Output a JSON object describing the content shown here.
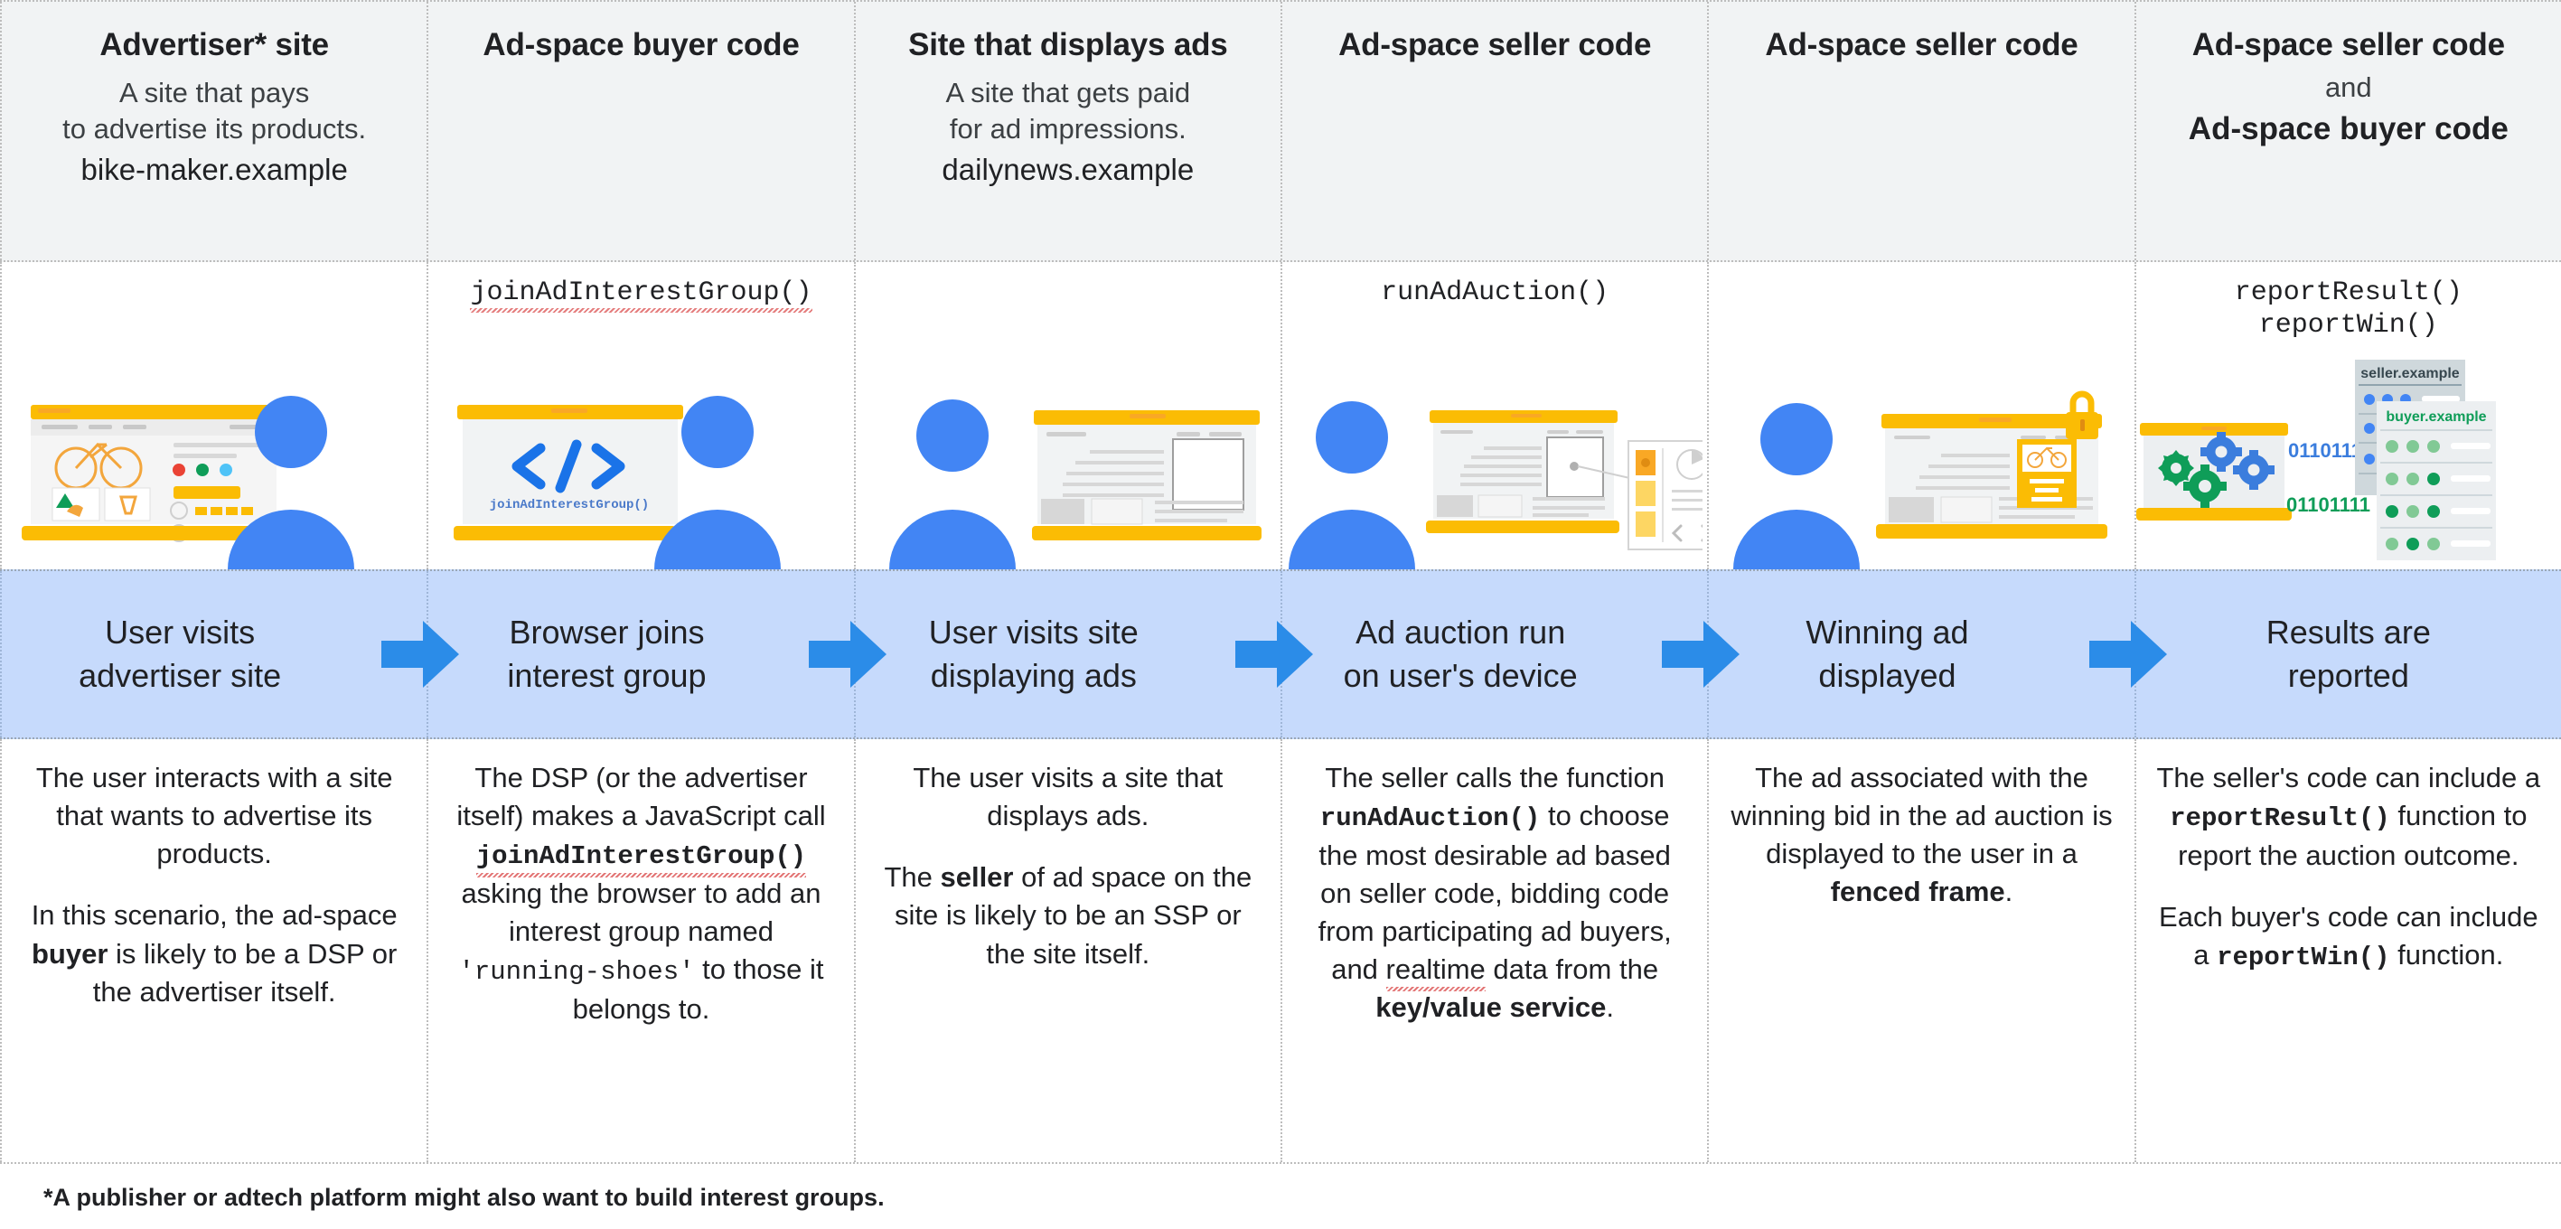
{
  "columns": [
    {
      "header": {
        "title": "Advertiser* site",
        "desc_lines": [
          "A site that pays",
          "to advertise its products."
        ],
        "domain": "bike-maker.example"
      },
      "api": "",
      "illustration": "user-at-advertiser-site-illustration",
      "flow": {
        "label_lines": [
          "User visits",
          "advertiser site"
        ],
        "arrow": true
      },
      "body": [
        {
          "parts": [
            {
              "t": "The user interacts with a site that wants to advertise its products.",
              "s": "plain"
            }
          ]
        },
        {
          "parts": [
            {
              "t": "In this scenario, the ad-space ",
              "s": "plain"
            },
            {
              "t": "buyer",
              "s": "bold"
            },
            {
              "t": " is likely to be a DSP or the advertiser itself.",
              "s": "plain"
            }
          ]
        }
      ]
    },
    {
      "header": {
        "title": "Ad-space buyer code",
        "desc_lines": [],
        "domain": ""
      },
      "api": "joinAdInterestGroup()",
      "api_squiggle": true,
      "illustration": "buyer-code-screen-illustration",
      "illustration_caption": "joinAdInterestGroup()",
      "flow": {
        "label_lines": [
          "Browser joins",
          "interest group"
        ],
        "arrow": true
      },
      "body": [
        {
          "parts": [
            {
              "t": "The DSP (or the advertiser itself) makes a JavaScript call ",
              "s": "plain"
            },
            {
              "t": "joinAdInterestGroup()",
              "s": "code-squiggle"
            },
            {
              "t": " asking the browser to add an interest group named ",
              "s": "plain"
            },
            {
              "t": "'running-shoes'",
              "s": "code-plain"
            },
            {
              "t": " to those it belongs to.",
              "s": "plain"
            }
          ]
        }
      ]
    },
    {
      "header": {
        "title": "Site that displays ads",
        "desc_lines": [
          "A site that gets paid",
          "for ad impressions."
        ],
        "domain": "dailynews.example"
      },
      "api": "",
      "illustration": "user-viewing-news-site-illustration",
      "flow": {
        "label_lines": [
          "User visits site",
          "displaying ads"
        ],
        "arrow": true
      },
      "body": [
        {
          "parts": [
            {
              "t": "The user visits a site that displays ads.",
              "s": "plain"
            }
          ]
        },
        {
          "parts": [
            {
              "t": "The ",
              "s": "plain"
            },
            {
              "t": "seller",
              "s": "bold"
            },
            {
              "t": " of ad space on the site is likely to be an SSP or the site itself.",
              "s": "plain"
            }
          ]
        }
      ]
    },
    {
      "header": {
        "title": "Ad-space seller code",
        "desc_lines": [],
        "domain": ""
      },
      "api": "runAdAuction()",
      "api_squiggle": false,
      "illustration": "ad-auction-on-device-illustration",
      "flow": {
        "label_lines": [
          "Ad auction run",
          "on user's device"
        ],
        "arrow": true
      },
      "body": [
        {
          "parts": [
            {
              "t": "The seller calls the function ",
              "s": "plain"
            },
            {
              "t": "runAdAuction()",
              "s": "code"
            },
            {
              "t": " to choose the most desirable ad based on seller code, bidding code from participating ad buyers, and ",
              "s": "plain"
            },
            {
              "t": "realtime",
              "s": "squiggle-plain"
            },
            {
              "t": " data from the ",
              "s": "plain"
            },
            {
              "t": "key/value service",
              "s": "bold"
            },
            {
              "t": ".",
              "s": "plain"
            }
          ]
        }
      ]
    },
    {
      "header": {
        "title": "Ad-space seller code",
        "desc_lines": [],
        "domain": ""
      },
      "api": "",
      "illustration": "winning-ad-fenced-frame-illustration",
      "flow": {
        "label_lines": [
          "Winning ad",
          "displayed"
        ],
        "arrow": true
      },
      "body": [
        {
          "parts": [
            {
              "t": "The ad associated with the winning bid in the ad auction is displayed to the user in a ",
              "s": "plain"
            },
            {
              "t": "fenced frame",
              "s": "bold"
            },
            {
              "t": ".",
              "s": "plain"
            }
          ]
        }
      ]
    },
    {
      "header": {
        "title": "Ad-space seller code",
        "and_label": "and",
        "title2": "Ad-space buyer code",
        "desc_lines": [],
        "domain": ""
      },
      "api": "reportResult()\nreportWin()",
      "api_squiggle": false,
      "illustration": "reporting-servers-illustration",
      "illustration_labels": {
        "seller_server": "seller.example",
        "buyer_server": "buyer.example",
        "binary_top": "0110111",
        "binary_bottom": "01101111"
      },
      "flow": {
        "label_lines": [
          "Results are",
          "reported"
        ],
        "arrow": false
      },
      "body": [
        {
          "parts": [
            {
              "t": "The seller's code can include a ",
              "s": "plain"
            },
            {
              "t": "reportResult()",
              "s": "code"
            },
            {
              "t": " function to report the auction outcome.",
              "s": "plain"
            }
          ]
        },
        {
          "parts": [
            {
              "t": "Each buyer's code can include a ",
              "s": "plain"
            },
            {
              "t": "reportWin()",
              "s": "code"
            },
            {
              "t": " function.",
              "s": "plain"
            }
          ]
        }
      ]
    }
  ],
  "footnote": "*A publisher or adtech platform might also want to build interest groups.",
  "colors": {
    "header_bg": "#f1f3f4",
    "flow_band_bg": "#c6dafc",
    "arrow_blue": "#2b8ce8",
    "brand_blue": "#4285f4",
    "person_blue": "#4285f4",
    "accent_yellow": "#fbbc04",
    "gear_green": "#0f9d58",
    "gear_blue": "#3b7ddd",
    "squiggle_red": "#e06666",
    "text": "#202124"
  }
}
